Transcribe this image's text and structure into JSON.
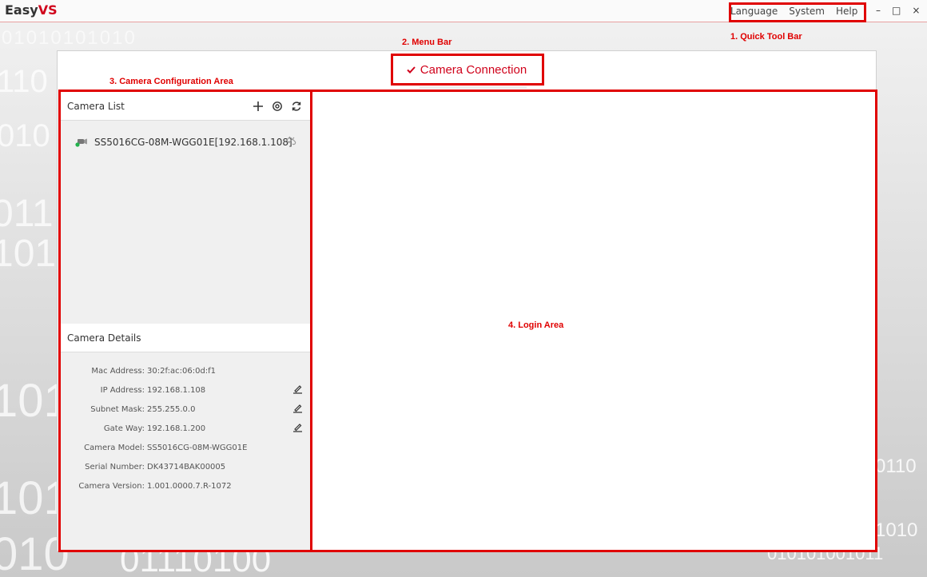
{
  "app": {
    "title_prefix": "Easy",
    "title_suffix": "VS"
  },
  "quick_tools": [
    "Language",
    "System",
    "Help"
  ],
  "window_controls": [
    "–",
    "□",
    "×"
  ],
  "menu": {
    "tab_label": "Camera Connection",
    "tab_icon": "check-icon"
  },
  "annotations": {
    "quick_tool_bar": "1. Quick Tool Bar",
    "menu_bar": "2. Menu Bar",
    "camera_config_area": "3. Camera Configuration Area",
    "login_area": "4. Login Area"
  },
  "camera_list": {
    "header": "Camera List",
    "tools": [
      "add-icon",
      "settings-icon",
      "refresh-icon"
    ],
    "items": [
      {
        "label": "SS5016CG-08M-WGG01E[192.168.1.108]"
      }
    ]
  },
  "camera_details": {
    "header": "Camera Details",
    "rows": [
      {
        "label": "Mac Address:",
        "value": "30:2f:ac:06:0d:f1",
        "editable": false
      },
      {
        "label": "IP Address:",
        "value": "192.168.1.108",
        "editable": true
      },
      {
        "label": "Subnet Mask:",
        "value": "255.255.0.0",
        "editable": true
      },
      {
        "label": "Gate Way:",
        "value": "192.168.1.200",
        "editable": true
      },
      {
        "label": "Camera Model:",
        "value": "SS5016CG-08M-WGG01E",
        "editable": false
      },
      {
        "label": "Serial Number:",
        "value": "DK43714BAK00005",
        "editable": false
      },
      {
        "label": "Camera Version:",
        "value": "1.001.0000.7.R-1072",
        "editable": false
      }
    ]
  },
  "colors": {
    "accent": "#d0021b",
    "annotation": "#e00000"
  }
}
